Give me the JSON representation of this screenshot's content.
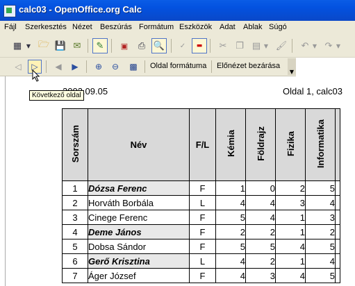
{
  "window": {
    "title": "calc03 - OpenOffice.org Calc"
  },
  "menu": [
    "Fájl",
    "Szerkesztés",
    "Nézet",
    "Beszúrás",
    "Formátum",
    "Eszközök",
    "Adat",
    "Ablak",
    "Súgó"
  ],
  "toolbar": {
    "page_format_label": "Oldal formátuma",
    "close_preview_label": "Előnézet bezárása"
  },
  "tooltip": "Következő oldal",
  "page_header": {
    "date": "2003.09.05",
    "page_info": "Oldal 1, calc03"
  },
  "sheet": {
    "headers": [
      "Sorszám",
      "Név",
      "F/L",
      "Kémia",
      "Földrajz",
      "Fizika",
      "Informatika"
    ],
    "rows": [
      {
        "no": "1",
        "name": "Dózsa Ferenc",
        "bold": true,
        "fl": "F",
        "v": [
          "1",
          "0",
          "2",
          "5"
        ]
      },
      {
        "no": "2",
        "name": "Horváth Borbála",
        "bold": false,
        "fl": "L",
        "v": [
          "4",
          "4",
          "3",
          "4"
        ]
      },
      {
        "no": "3",
        "name": "Cinege Ferenc",
        "bold": false,
        "fl": "F",
        "v": [
          "5",
          "4",
          "1",
          "3"
        ]
      },
      {
        "no": "4",
        "name": "Deme János",
        "bold": true,
        "fl": "F",
        "v": [
          "2",
          "2",
          "1",
          "2"
        ]
      },
      {
        "no": "5",
        "name": "Dobsa Sándor",
        "bold": false,
        "fl": "F",
        "v": [
          "5",
          "5",
          "4",
          "5"
        ]
      },
      {
        "no": "6",
        "name": "Gerő Krisztina",
        "bold": true,
        "fl": "L",
        "v": [
          "4",
          "2",
          "1",
          "4"
        ]
      },
      {
        "no": "7",
        "name": "Áger József",
        "bold": false,
        "fl": "F",
        "v": [
          "4",
          "3",
          "4",
          "5"
        ]
      }
    ]
  }
}
